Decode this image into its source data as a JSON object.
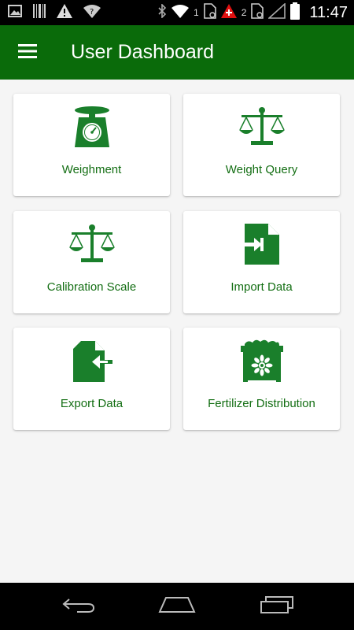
{
  "status_bar": {
    "time": "11:47",
    "sim1_label": "1",
    "sim2_label": "2",
    "icons": [
      "image-icon",
      "barcode-icon",
      "warning-icon",
      "wifi-question-icon",
      "bluetooth-icon",
      "wifi-icon",
      "sim1-icon",
      "swiss-flag-icon",
      "sim2-icon",
      "signal-icon",
      "battery-icon"
    ]
  },
  "app_bar": {
    "title": "User Dashboard",
    "menu_icon": "hamburger-menu-icon"
  },
  "colors": {
    "primary": "#0a6b0a",
    "icon_green": "#1a7f2b",
    "label_green": "#136e13",
    "background": "#f5f5f5"
  },
  "menu": [
    {
      "label": "Weighment",
      "icon": "kitchen-scale-icon"
    },
    {
      "label": "Weight Query",
      "icon": "balance-scale-icon"
    },
    {
      "label": "Calibration Scale",
      "icon": "balance-scale-icon"
    },
    {
      "label": "Import Data",
      "icon": "file-import-icon"
    },
    {
      "label": "Export Data",
      "icon": "file-export-icon"
    },
    {
      "label": "Fertilizer Distribution",
      "icon": "fertilizer-bin-icon"
    }
  ],
  "nav_bar": {
    "icons": [
      "back-icon",
      "home-icon",
      "recent-apps-icon"
    ]
  }
}
